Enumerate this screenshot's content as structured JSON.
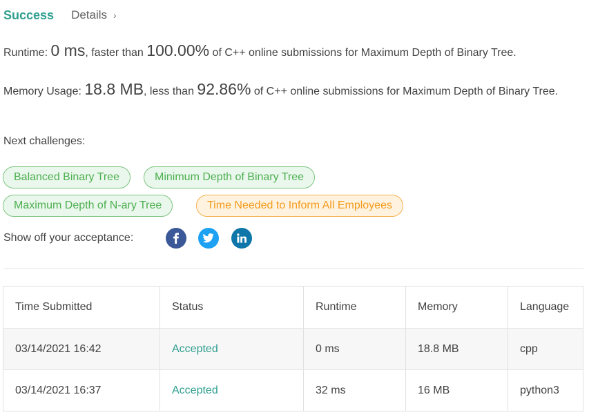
{
  "header": {
    "title": "Success",
    "details_label": "Details",
    "details_chevron": "›"
  },
  "runtime": {
    "label": "Runtime:",
    "value": "0 ms",
    "comparison": ", faster than",
    "percent": "100.00%",
    "suffix": "of C++ online submissions for Maximum Depth of Binary Tree."
  },
  "memory": {
    "label": "Memory Usage:",
    "value": "18.8 MB",
    "comparison": ", less than",
    "percent": "92.86%",
    "suffix": "of C++ online submissions for Maximum Depth of Binary Tree."
  },
  "next_challenges": {
    "label": "Next challenges:",
    "items": [
      {
        "label": "Balanced Binary Tree",
        "difficulty_color": "green"
      },
      {
        "label": "Minimum Depth of Binary Tree",
        "difficulty_color": "green"
      },
      {
        "label": "Maximum Depth of N-ary Tree",
        "difficulty_color": "green"
      },
      {
        "label": "Time Needed to Inform All Employees",
        "difficulty_color": "orange"
      }
    ]
  },
  "share": {
    "label": "Show off your acceptance:",
    "icons": [
      {
        "name": "facebook-icon",
        "color": "#3b5998"
      },
      {
        "name": "twitter-icon",
        "color": "#1da1f2"
      },
      {
        "name": "linkedin-icon",
        "color": "#0e76a8"
      }
    ]
  },
  "submissions": {
    "columns": [
      "Time Submitted",
      "Status",
      "Runtime",
      "Memory",
      "Language"
    ],
    "rows": [
      {
        "time": "03/14/2021 16:42",
        "status": "Accepted",
        "runtime": "0 ms",
        "memory": "18.8 MB",
        "language": "cpp"
      },
      {
        "time": "03/14/2021 16:37",
        "status": "Accepted",
        "runtime": "32 ms",
        "memory": "16 MB",
        "language": "python3"
      }
    ]
  },
  "colors": {
    "accent_teal": "#2e9e8f",
    "tag_green": "#4caf50",
    "tag_orange": "#f39a1b"
  }
}
